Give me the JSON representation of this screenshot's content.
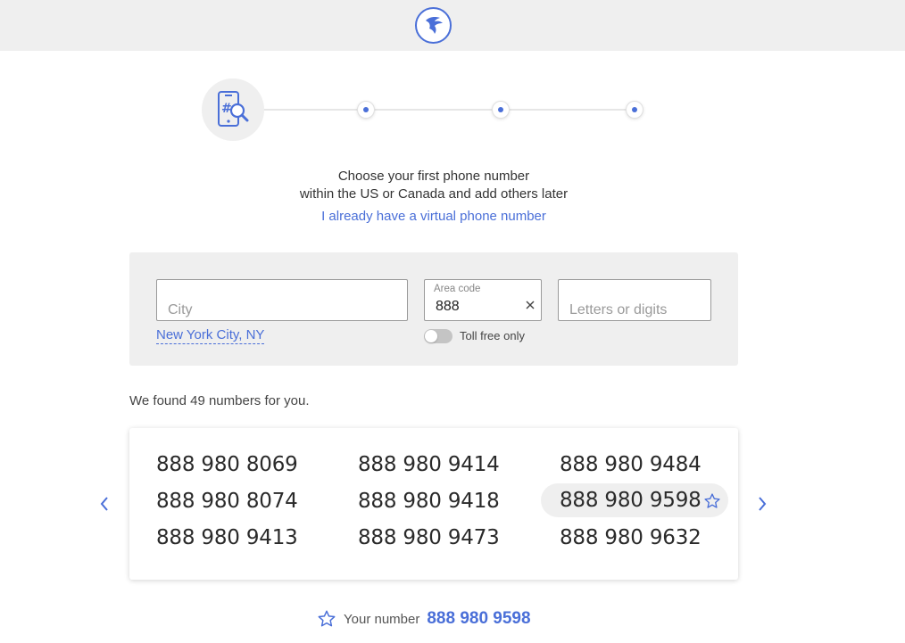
{
  "header": {
    "logo_icon": "bird-logo-icon",
    "accent_color": "#4a6fd8"
  },
  "stepper": {
    "active_icon": "phone-search-icon",
    "step_count": 4
  },
  "intro": {
    "line1": "Choose your first phone number",
    "line2": "within the US or Canada and add others later",
    "already_link": "I already have a virtual phone number"
  },
  "search": {
    "city_placeholder": "City",
    "city_value": "",
    "area_label": "Area code",
    "area_value": "888",
    "letters_placeholder": "Letters or digits",
    "letters_value": "",
    "city_suggestion": "New York City, NY",
    "toll_free_label": "Toll free only",
    "toll_free_on": false
  },
  "results": {
    "found_text": "We found 49 numbers for you.",
    "numbers": [
      "888 980 8069",
      "888 980 9414",
      "888 980 9484",
      "888 980 8074",
      "888 980 9418",
      "888 980 9598",
      "888 980 9413",
      "888 980 9473",
      "888 980 9632"
    ],
    "selected_index": 5
  },
  "your_number": {
    "label": "Your number",
    "value": "888 980 9598"
  }
}
